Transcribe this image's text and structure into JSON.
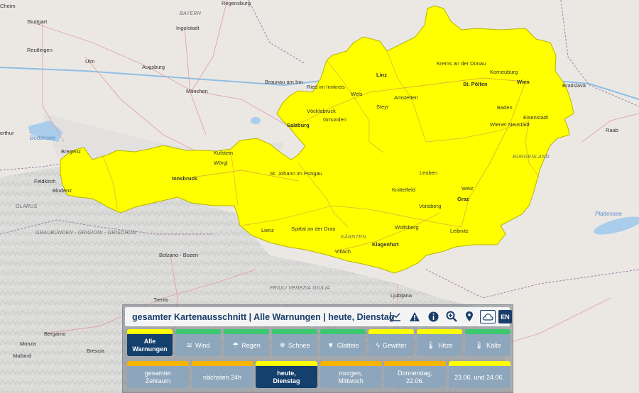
{
  "map": {
    "labels": {
      "cities_bold": [
        "Linz",
        "St. Pölten",
        "Wien",
        "Salzburg",
        "Innsbruck",
        "Graz",
        "Klagenfurt",
        "Bratislava"
      ],
      "places": [
        "Cheim",
        "Regensburg",
        "Stuttgart",
        "Ingolstadt",
        "Reutlingen",
        "Ulm",
        "Augsburg",
        "München",
        "Braunau am Inn",
        "Ried im Innkreis",
        "Wels",
        "Krems an der Donau",
        "Korneuburg",
        "Amstetten",
        "Steyr",
        "Vöcklabruck",
        "Gmunden",
        "Baden",
        "Eisenstadt",
        "Wiener Neustadt",
        "Raab",
        "Bregenz",
        "Feldkirch",
        "Bludenz",
        "Kufstein",
        "Wörgl",
        "St. Johann im Pongau",
        "Leoben",
        "Knittelfeld",
        "Weiz",
        "Voitsberg",
        "Leibnitz",
        "Wolfsberg",
        "Spittal an der Drau",
        "Lienz",
        "Villach",
        "Bolzano - Bozen",
        "Trento",
        "Ljubljana",
        "Bergamo",
        "Monza",
        "Brescia",
        "Mailand",
        "erthur"
      ],
      "regions": [
        "BAYERN",
        "BURGENLAND",
        "KÄRNTEN",
        "GLARUS",
        "GRAUBÜNDEN - GRIGIONI - GRISCHUN",
        "FRIULI VENEZIA GIULIA"
      ],
      "waters": [
        "Bodensee",
        "Plattensee"
      ]
    },
    "warning_color": "#ffff00",
    "warning_border": "#b8b800"
  },
  "panel": {
    "title": "gesamter Kartenausschnitt | Alle Warnungen | heute, Dienstag",
    "icons": [
      "chart-icon",
      "warning-icon",
      "info-icon",
      "zoom-search-icon",
      "location-pin-icon",
      "cloud-icon"
    ],
    "lang": "EN",
    "types": [
      {
        "label_1": "Alle",
        "label_2": "Warnungen",
        "icon": "",
        "bar": "#ffff00",
        "active": true
      },
      {
        "label_1": "Wind",
        "label_2": "",
        "icon": "≋",
        "bar": "#3cc86e",
        "active": false
      },
      {
        "label_1": "Regen",
        "label_2": "",
        "icon": "☂",
        "bar": "#3cc86e",
        "active": false
      },
      {
        "label_1": "Schnee",
        "label_2": "",
        "icon": "❄",
        "bar": "#3cc86e",
        "active": false
      },
      {
        "label_1": "Glatteis",
        "label_2": "",
        "icon": "▼",
        "bar": "#3cc86e",
        "active": false
      },
      {
        "label_1": "Gewitter",
        "label_2": "",
        "icon": "ϟ",
        "bar": "#ffff00",
        "active": false
      },
      {
        "label_1": "Hitze",
        "label_2": "",
        "icon": "🌡",
        "bar": "#ffff00",
        "active": false
      },
      {
        "label_1": "Kälte",
        "label_2": "",
        "icon": "🌡",
        "bar": "#3cc86e",
        "active": false
      }
    ],
    "times": [
      {
        "label_1": "gesamter",
        "label_2": "Zeitraum",
        "bar": "#f5b400",
        "active": false
      },
      {
        "label_1": "nächsten 24h",
        "label_2": "",
        "bar": "#f5b400",
        "active": false
      },
      {
        "label_1": "heute,",
        "label_2": "Dienstag",
        "bar": "#ffff00",
        "active": true
      },
      {
        "label_1": "morgen,",
        "label_2": "Mittwoch",
        "bar": "#f5b400",
        "active": false
      },
      {
        "label_1": "Donnerstag,",
        "label_2": "22.06.",
        "bar": "#f5b400",
        "active": false
      },
      {
        "label_1": "23.06. und 24.06.",
        "label_2": "",
        "bar": "#ffff00",
        "active": false
      }
    ]
  }
}
